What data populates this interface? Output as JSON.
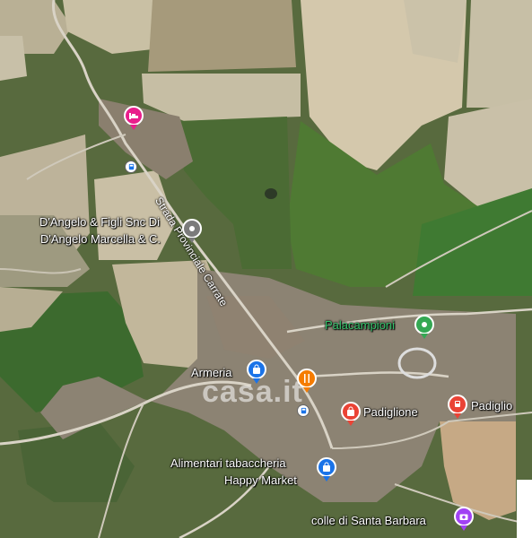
{
  "map": {
    "watermark": "casa.it",
    "road_label": "Strada Provinciale Carrate",
    "places": [
      {
        "label": "D'Angelo & Figli Snc Di",
        "label2": "D'Angelo Marcella & C.",
        "icon": "pin-icon",
        "color": "#7b7b7b"
      },
      {
        "label": "Palacampioni",
        "icon": "pin-icon",
        "color": "#34a853"
      },
      {
        "label": "Armeria",
        "icon": "shopping-bag-icon",
        "color": "#1a73e8"
      },
      {
        "label": "Padiglione",
        "icon": "shopping-bag-icon",
        "color": "#ea4335"
      },
      {
        "label": "Padiglio",
        "icon": "train-icon",
        "color": "#ea4335"
      },
      {
        "label": "Alimentari tabaccheria",
        "label2": "Happy Market",
        "icon": "shopping-bag-icon",
        "color": "#1a73e8"
      },
      {
        "label": "colle di Santa Barbara",
        "icon": "camera-icon",
        "color": "#a142f4"
      },
      {
        "label": "",
        "icon": "bed-icon",
        "color": "#e91e8c"
      },
      {
        "label": "",
        "icon": "fork-knife-icon",
        "color": "#f57c00"
      }
    ],
    "transit_stops": [
      "bus-icon",
      "bus-icon"
    ]
  }
}
